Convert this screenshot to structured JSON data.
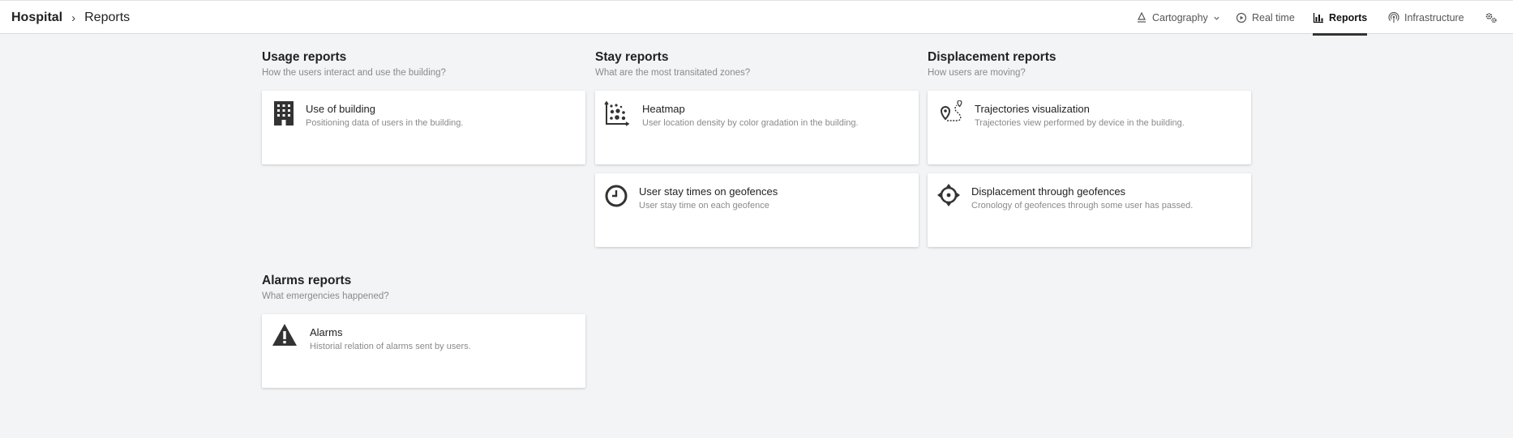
{
  "header": {
    "breadcrumb_root": "Hospital",
    "breadcrumb_separator": "›",
    "breadcrumb_current": "Reports"
  },
  "nav": {
    "items": [
      {
        "label": "Cartography",
        "icon": "cartography-icon",
        "has_dropdown": true,
        "active": false
      },
      {
        "label": "Real time",
        "icon": "play-circle-icon",
        "active": false
      },
      {
        "label": "Reports",
        "icon": "bar-chart-icon",
        "active": true
      },
      {
        "label": "Infrastructure",
        "icon": "antenna-icon",
        "active": false
      }
    ],
    "settings_icon": "gears-icon"
  },
  "sections": {
    "usage": {
      "title": "Usage reports",
      "subtitle": "How the users interact and use the building?",
      "cards": [
        {
          "title": "Use of building",
          "description": "Positioning data of users in the building.",
          "icon": "building-icon"
        }
      ]
    },
    "stay": {
      "title": "Stay reports",
      "subtitle": "What are the most transitated zones?",
      "cards": [
        {
          "title": "Heatmap",
          "description": "User location density by color gradation in the building.",
          "icon": "heatmap-icon"
        },
        {
          "title": "User stay times on geofences",
          "description": "User stay time on each geofence",
          "icon": "clock-icon"
        }
      ]
    },
    "displacement": {
      "title": "Displacement reports",
      "subtitle": "How users are moving?",
      "cards": [
        {
          "title": "Trajectories visualization",
          "description": "Trajectories view performed by device in the building.",
          "icon": "trajectory-icon"
        },
        {
          "title": "Displacement through geofences",
          "description": "Cronology of geofences through some user has passed.",
          "icon": "crosshair-icon"
        }
      ]
    },
    "alarms": {
      "title": "Alarms reports",
      "subtitle": "What emergencies happened?",
      "cards": [
        {
          "title": "Alarms",
          "description": "Historial relation of alarms sent by users.",
          "icon": "warning-icon"
        }
      ]
    }
  },
  "colors": {
    "background": "#f3f4f6",
    "card": "#ffffff",
    "text": "#222222",
    "muted": "#8a8a8a",
    "active_underline": "#333333"
  }
}
